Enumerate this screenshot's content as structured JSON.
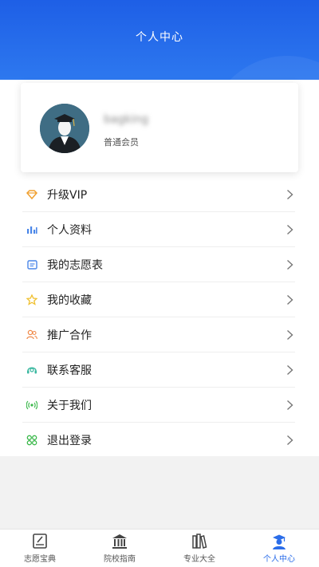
{
  "header": {
    "title": "个人中心"
  },
  "profile": {
    "username": "bagking",
    "level": "普通会员"
  },
  "menu": {
    "items": [
      {
        "label": "升级VIP",
        "icon": "diamond-icon",
        "color": "#f0a030"
      },
      {
        "label": "个人资料",
        "icon": "bar-chart-icon",
        "color": "#4a86e8"
      },
      {
        "label": "我的志愿表",
        "icon": "form-icon",
        "color": "#4a86e8"
      },
      {
        "label": "我的收藏",
        "icon": "star-icon",
        "color": "#f0c030"
      },
      {
        "label": "推广合作",
        "icon": "people-icon",
        "color": "#f08a4a"
      },
      {
        "label": "联系客服",
        "icon": "headset-icon",
        "color": "#3ab8a0"
      },
      {
        "label": "关于我们",
        "icon": "broadcast-icon",
        "color": "#3ab84a"
      },
      {
        "label": "退出登录",
        "icon": "grid-icon",
        "color": "#3ab84a"
      }
    ]
  },
  "tabbar": {
    "tabs": [
      {
        "label": "志愿宝典",
        "icon": "book-edit-icon",
        "active": false
      },
      {
        "label": "院校指南",
        "icon": "building-icon",
        "active": false
      },
      {
        "label": "专业大全",
        "icon": "books-icon",
        "active": false
      },
      {
        "label": "个人中心",
        "icon": "graduate-icon",
        "active": true
      }
    ]
  },
  "colors": {
    "primary": "#2b6de9",
    "background": "#f2f2f2"
  }
}
